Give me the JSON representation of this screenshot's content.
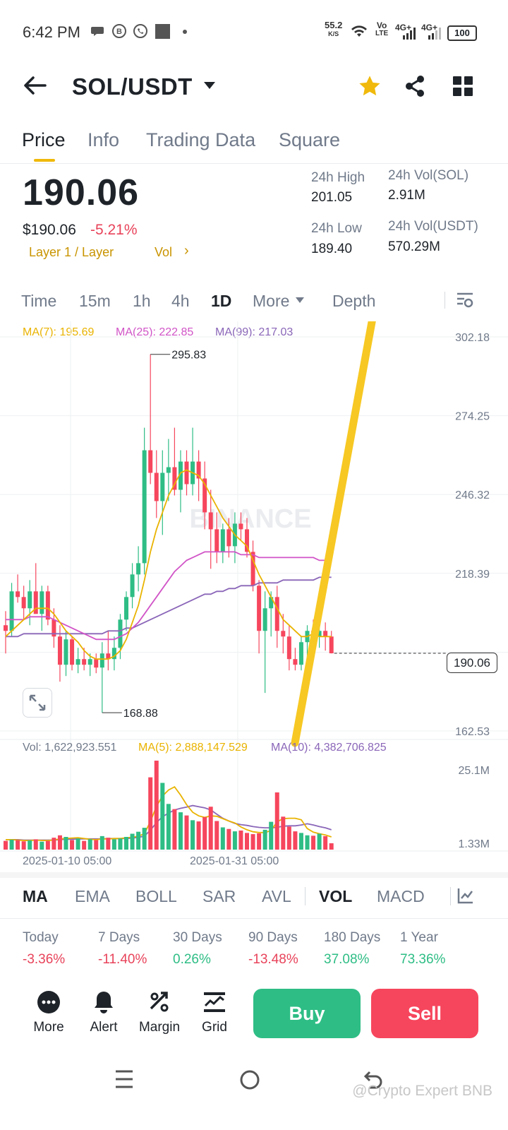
{
  "status_bar": {
    "time": "6:42 PM",
    "net_speed_value": "55.2",
    "net_speed_unit": "K/S",
    "volte_top": "Vo",
    "volte_bottom": "LTE",
    "sim1": "4G+",
    "sim2": "4G+",
    "battery": "100"
  },
  "header": {
    "pair": "SOL/USDT"
  },
  "tabs": [
    "Price",
    "Info",
    "Trading Data",
    "Square"
  ],
  "price": {
    "last": "190.06",
    "usd": "$190.06",
    "change": "-5.21%",
    "tag1": "Layer 1 / Layer",
    "tag2": "Vol",
    "tag2_arrow": "›"
  },
  "stats": {
    "high_label": "24h High",
    "high_value": "201.05",
    "low_label": "24h Low",
    "low_value": "189.40",
    "vol_base_label": "24h Vol(SOL)",
    "vol_base_value": "2.91M",
    "vol_quote_label": "24h Vol(USDT)",
    "vol_quote_value": "570.29M"
  },
  "intervals": [
    "Time",
    "15m",
    "1h",
    "4h",
    "1D",
    "More",
    "Depth"
  ],
  "ma_legend": {
    "ma7": "MA(7): 195.69",
    "ma25": "MA(25): 222.85",
    "ma99": "MA(99): 217.03"
  },
  "chart": {
    "axis_labels": [
      "302.18",
      "274.25",
      "246.32",
      "218.39",
      "162.53"
    ],
    "high_marker": "295.83",
    "low_marker": "168.88",
    "current_price": "190.06",
    "watermark": "BINANCE",
    "colors": {
      "up": "#2ebd85",
      "down": "#f6465d",
      "ma7": "#e9b300",
      "ma25": "#d154c7",
      "ma99": "#8a66b8"
    }
  },
  "chart_data": {
    "type": "candlestick",
    "y_axis_ticks": [
      302.18,
      274.25,
      246.32,
      218.39,
      162.53
    ],
    "y_range": [
      162.53,
      302.18
    ],
    "candles": [
      {
        "o": 200,
        "h": 205,
        "l": 190,
        "c": 198
      },
      {
        "o": 198,
        "h": 215,
        "l": 196,
        "c": 212
      },
      {
        "o": 212,
        "h": 218,
        "l": 208,
        "c": 210
      },
      {
        "o": 210,
        "h": 214,
        "l": 202,
        "c": 206
      },
      {
        "o": 206,
        "h": 216,
        "l": 200,
        "c": 212
      },
      {
        "o": 212,
        "h": 222,
        "l": 208,
        "c": 204
      },
      {
        "o": 204,
        "h": 214,
        "l": 198,
        "c": 212
      },
      {
        "o": 212,
        "h": 214,
        "l": 200,
        "c": 202
      },
      {
        "o": 202,
        "h": 206,
        "l": 192,
        "c": 196
      },
      {
        "o": 196,
        "h": 200,
        "l": 180,
        "c": 186
      },
      {
        "o": 186,
        "h": 198,
        "l": 182,
        "c": 195
      },
      {
        "o": 195,
        "h": 196,
        "l": 184,
        "c": 186
      },
      {
        "o": 186,
        "h": 192,
        "l": 183,
        "c": 188
      },
      {
        "o": 188,
        "h": 192,
        "l": 184,
        "c": 186
      },
      {
        "o": 186,
        "h": 190,
        "l": 182,
        "c": 188
      },
      {
        "o": 188,
        "h": 190,
        "l": 183,
        "c": 185
      },
      {
        "o": 185,
        "h": 194,
        "l": 169,
        "c": 190
      },
      {
        "o": 190,
        "h": 198,
        "l": 184,
        "c": 188
      },
      {
        "o": 188,
        "h": 196,
        "l": 184,
        "c": 192
      },
      {
        "o": 192,
        "h": 204,
        "l": 188,
        "c": 202
      },
      {
        "o": 202,
        "h": 212,
        "l": 198,
        "c": 210
      },
      {
        "o": 210,
        "h": 222,
        "l": 206,
        "c": 218
      },
      {
        "o": 218,
        "h": 228,
        "l": 212,
        "c": 222
      },
      {
        "o": 222,
        "h": 270,
        "l": 218,
        "c": 262
      },
      {
        "o": 262,
        "h": 296,
        "l": 250,
        "c": 254
      },
      {
        "o": 254,
        "h": 262,
        "l": 238,
        "c": 244
      },
      {
        "o": 244,
        "h": 262,
        "l": 232,
        "c": 254
      },
      {
        "o": 254,
        "h": 266,
        "l": 244,
        "c": 256
      },
      {
        "o": 256,
        "h": 270,
        "l": 246,
        "c": 248
      },
      {
        "o": 248,
        "h": 262,
        "l": 240,
        "c": 258
      },
      {
        "o": 258,
        "h": 262,
        "l": 246,
        "c": 250
      },
      {
        "o": 250,
        "h": 270,
        "l": 246,
        "c": 258
      },
      {
        "o": 258,
        "h": 262,
        "l": 244,
        "c": 252
      },
      {
        "o": 252,
        "h": 258,
        "l": 234,
        "c": 240
      },
      {
        "o": 240,
        "h": 248,
        "l": 220,
        "c": 234
      },
      {
        "o": 234,
        "h": 240,
        "l": 222,
        "c": 226
      },
      {
        "o": 226,
        "h": 236,
        "l": 222,
        "c": 234
      },
      {
        "o": 234,
        "h": 238,
        "l": 224,
        "c": 228
      },
      {
        "o": 228,
        "h": 240,
        "l": 222,
        "c": 236
      },
      {
        "o": 236,
        "h": 240,
        "l": 230,
        "c": 234
      },
      {
        "o": 234,
        "h": 238,
        "l": 224,
        "c": 226
      },
      {
        "o": 226,
        "h": 230,
        "l": 212,
        "c": 214
      },
      {
        "o": 214,
        "h": 216,
        "l": 190,
        "c": 198
      },
      {
        "o": 198,
        "h": 212,
        "l": 176,
        "c": 206
      },
      {
        "o": 206,
        "h": 212,
        "l": 196,
        "c": 210
      },
      {
        "o": 210,
        "h": 214,
        "l": 192,
        "c": 198
      },
      {
        "o": 198,
        "h": 204,
        "l": 190,
        "c": 196
      },
      {
        "o": 196,
        "h": 200,
        "l": 184,
        "c": 188
      },
      {
        "o": 188,
        "h": 192,
        "l": 184,
        "c": 186
      },
      {
        "o": 186,
        "h": 196,
        "l": 184,
        "c": 194
      },
      {
        "o": 194,
        "h": 200,
        "l": 188,
        "c": 198
      },
      {
        "o": 198,
        "h": 202,
        "l": 192,
        "c": 196
      },
      {
        "o": 196,
        "h": 202,
        "l": 192,
        "c": 198
      },
      {
        "o": 198,
        "h": 201,
        "l": 191,
        "c": 196
      },
      {
        "o": 196,
        "h": 198,
        "l": 190,
        "c": 190.06
      }
    ],
    "ma7": [
      196,
      198,
      200,
      202,
      204,
      206,
      206,
      206,
      204,
      201,
      198,
      196,
      194,
      191,
      189,
      188,
      188,
      188,
      189,
      191,
      195,
      201,
      207,
      216,
      226,
      234,
      240,
      246,
      250,
      254,
      255,
      254,
      253,
      250,
      246,
      242,
      238,
      235,
      232,
      230,
      228,
      223,
      218,
      214,
      210,
      206,
      202,
      200,
      198,
      196,
      196,
      197,
      196,
      196,
      196
    ],
    "ma25": [
      202,
      202,
      202,
      202,
      203,
      203,
      203,
      203,
      202,
      201,
      200,
      199,
      198,
      197,
      196,
      195,
      195,
      195,
      195,
      196,
      197,
      199,
      201,
      204,
      207,
      210,
      213,
      216,
      219,
      221,
      223,
      224,
      225,
      226,
      226,
      226,
      226,
      226,
      226,
      225,
      225,
      225,
      224,
      224,
      224,
      224,
      224,
      224,
      224,
      224,
      224,
      224,
      223,
      223,
      222
    ],
    "ma99": [
      196,
      196,
      196,
      197,
      197,
      197,
      197,
      197,
      197,
      197,
      197,
      197,
      197,
      197,
      197,
      197,
      197,
      198,
      198,
      198,
      199,
      199,
      200,
      201,
      202,
      203,
      204,
      205,
      206,
      207,
      208,
      209,
      210,
      211,
      211,
      212,
      212,
      213,
      213,
      214,
      214,
      214,
      215,
      215,
      215,
      215,
      216,
      216,
      216,
      216,
      216,
      216,
      217,
      217,
      217
    ],
    "volume": {
      "legend_vol": "Vol: 1,622,923.551",
      "legend_ma5": "MA(5): 2,888,147.529",
      "legend_ma10": "MA(10): 4,382,706.825",
      "axis_top": "25.1M",
      "axis_bottom": "1.33M",
      "values": [
        2.2,
        2.5,
        2.4,
        2.1,
        2.3,
        2.6,
        2.0,
        2.2,
        3.0,
        3.6,
        3.2,
        2.4,
        2.8,
        2.2,
        2.6,
        2.4,
        3.4,
        3.0,
        2.6,
        2.8,
        3.2,
        4.0,
        4.5,
        5.5,
        18.2,
        22.4,
        16.8,
        11.5,
        10.2,
        9.4,
        8.6,
        7.4,
        7.1,
        8.2,
        10.8,
        7.2,
        5.6,
        5.2,
        4.6,
        4.8,
        4.2,
        3.9,
        4.1,
        5.0,
        7.0,
        14.4,
        8.3,
        5.8,
        4.6,
        4.2,
        3.6,
        3.5,
        4.0,
        3.4,
        1.6
      ],
      "ma5": [
        2.5,
        2.5,
        2.4,
        2.3,
        2.3,
        2.4,
        2.3,
        2.3,
        2.4,
        2.7,
        2.8,
        2.9,
        3.0,
        2.8,
        2.6,
        2.5,
        2.7,
        2.7,
        2.8,
        2.8,
        3.0,
        3.1,
        3.4,
        4.0,
        7.1,
        10.9,
        13.5,
        15.0,
        15.8,
        13.7,
        11.3,
        9.4,
        8.5,
        8.1,
        8.5,
        8.4,
        7.8,
        7.2,
        6.7,
        5.7,
        5.0,
        4.5,
        4.3,
        4.3,
        4.8,
        7.0,
        7.8,
        7.9,
        7.9,
        7.5,
        5.3,
        4.4,
        4.0,
        3.7,
        3.2
      ],
      "ma10": [
        2.5,
        2.5,
        2.5,
        2.4,
        2.4,
        2.4,
        2.4,
        2.4,
        2.4,
        2.5,
        2.6,
        2.6,
        2.7,
        2.7,
        2.7,
        2.7,
        2.7,
        2.8,
        2.8,
        2.8,
        2.8,
        2.9,
        3.1,
        3.4,
        4.9,
        6.8,
        8.3,
        9.2,
        10.0,
        10.4,
        10.7,
        11.1,
        10.8,
        10.5,
        10.0,
        8.9,
        7.9,
        7.2,
        6.6,
        6.3,
        6.1,
        5.8,
        5.6,
        5.5,
        5.5,
        5.6,
        5.9,
        6.0,
        6.0,
        6.2,
        6.5,
        6.2,
        5.8,
        5.5,
        5.0
      ]
    },
    "x_labels": [
      "2025-01-10 05:00",
      "2025-01-31 05:00"
    ]
  },
  "indicators": [
    "MA",
    "EMA",
    "BOLL",
    "SAR",
    "AVL",
    "VOL",
    "MACD"
  ],
  "performance": [
    {
      "label": "Today",
      "value": "-3.36%",
      "dir": "neg"
    },
    {
      "label": "7 Days",
      "value": "-11.40%",
      "dir": "neg"
    },
    {
      "label": "30 Days",
      "value": "0.26%",
      "dir": "pos"
    },
    {
      "label": "90 Days",
      "value": "-13.48%",
      "dir": "neg"
    },
    {
      "label": "180 Days",
      "value": "37.08%",
      "dir": "pos"
    },
    {
      "label": "1 Year",
      "value": "73.36%",
      "dir": "pos"
    }
  ],
  "actions": {
    "more": "More",
    "alert": "Alert",
    "margin": "Margin",
    "grid": "Grid",
    "buy": "Buy",
    "sell": "Sell"
  },
  "footer_watermark": "@Crypto Expert BNB"
}
